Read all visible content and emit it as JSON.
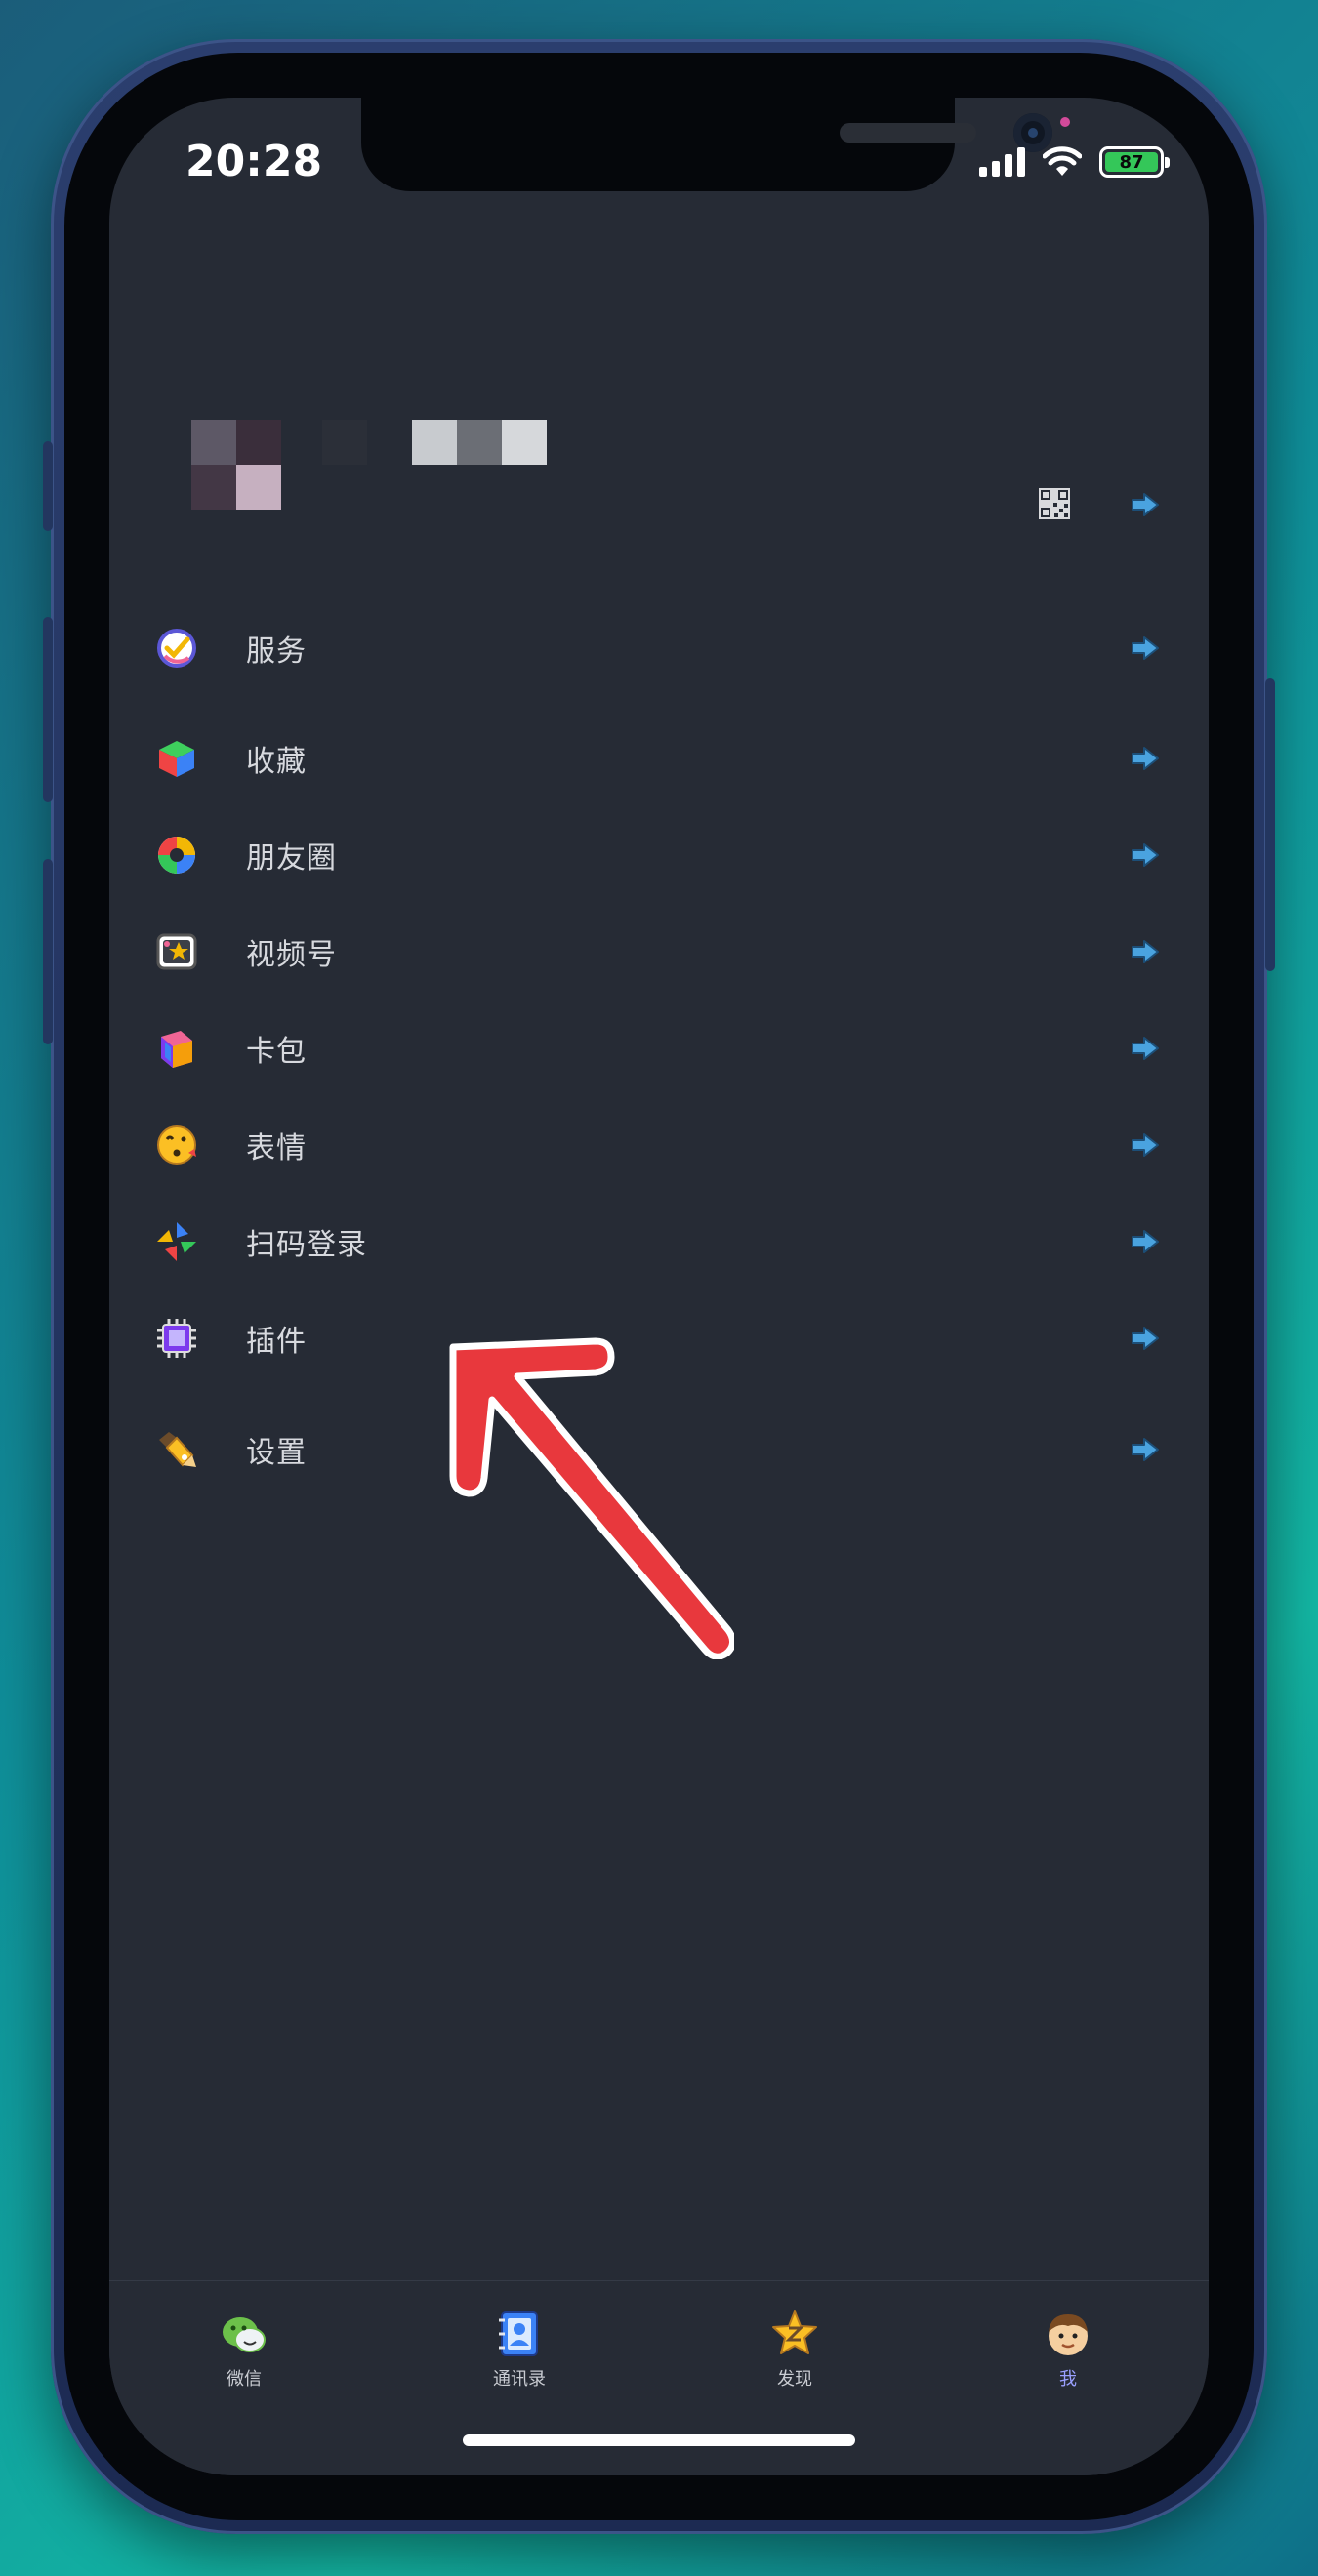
{
  "status_bar": {
    "time": "20:28",
    "battery": "87"
  },
  "menu": {
    "items": [
      {
        "id": "services",
        "label": "服务",
        "icon": "services-icon"
      },
      {
        "id": "favorites",
        "label": "收藏",
        "icon": "cube-icon"
      },
      {
        "id": "moments",
        "label": "朋友圈",
        "icon": "moments-icon"
      },
      {
        "id": "channels",
        "label": "视频号",
        "icon": "channels-icon"
      },
      {
        "id": "cards",
        "label": "卡包",
        "icon": "cards-icon"
      },
      {
        "id": "stickers",
        "label": "表情",
        "icon": "emoji-icon"
      },
      {
        "id": "scan-login",
        "label": "扫码登录",
        "icon": "scan-icon"
      },
      {
        "id": "plugins",
        "label": "插件",
        "icon": "plugin-icon"
      },
      {
        "id": "settings",
        "label": "设置",
        "icon": "settings-icon"
      }
    ]
  },
  "tabbar": {
    "tabs": [
      {
        "label": "微信",
        "icon": "chat-icon",
        "active": false
      },
      {
        "label": "通讯录",
        "icon": "contacts-icon",
        "active": false
      },
      {
        "label": "发现",
        "icon": "discover-icon",
        "active": false
      },
      {
        "label": "我",
        "icon": "me-icon",
        "active": true
      }
    ]
  },
  "colors": {
    "screen_bg": "#262b35",
    "arrow_red": "#e8383d",
    "active_tab": "#9aa0ff"
  }
}
